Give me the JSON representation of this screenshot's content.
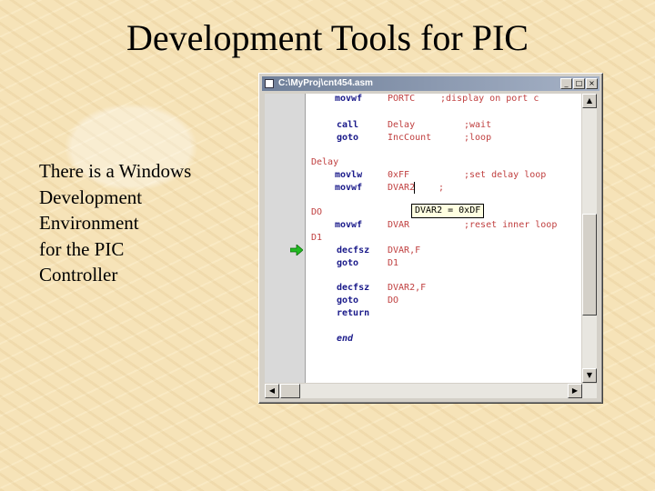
{
  "slide": {
    "title": "Development Tools for PIC",
    "body_lines": [
      "There is a Windows",
      "Development",
      "Environment",
      "for the PIC",
      "Controller"
    ]
  },
  "window": {
    "title": "C:\\MyProj\\cnt454.asm",
    "buttons": {
      "minimize": "_",
      "maximize": "□",
      "close": "×"
    }
  },
  "code": {
    "lines": [
      {
        "label": "",
        "op": "movwf",
        "arg": "PORTC",
        "comment": ";display on port c"
      },
      {
        "label": "",
        "op": "call",
        "arg": "Delay",
        "comment": ";wait"
      },
      {
        "label": "",
        "op": "goto",
        "arg": "IncCount",
        "comment": ";loop"
      },
      {
        "label": "Delay",
        "op": "",
        "arg": "",
        "comment": ""
      },
      {
        "label": "",
        "op": "movlw",
        "arg": "0xFF",
        "comment": ";set delay loop"
      },
      {
        "label": "",
        "op": "movwf",
        "arg": "DVAR2",
        "comment": ";"
      },
      {
        "label": "DO",
        "op": "",
        "arg": "",
        "comment": ""
      },
      {
        "label": "",
        "op": "movwf",
        "arg": "DVAR",
        "comment": ";reset inner loop"
      },
      {
        "label": "D1",
        "op": "",
        "arg": "",
        "comment": ""
      },
      {
        "label": "",
        "op": "decfsz",
        "arg": "DVAR,F",
        "comment": ""
      },
      {
        "label": "",
        "op": "goto",
        "arg": "D1",
        "comment": ""
      },
      {
        "label": "",
        "op": "decfsz",
        "arg": "DVAR2,F",
        "comment": ""
      },
      {
        "label": "",
        "op": "goto",
        "arg": "DO",
        "comment": ""
      },
      {
        "label": "",
        "op": "return",
        "arg": "",
        "comment": ""
      },
      {
        "label": "",
        "op": "end",
        "arg": "",
        "comment": ""
      }
    ],
    "tooltip": "DVAR2 = 0xDF"
  },
  "icons": {
    "execution_pointer": "green-arrow-icon",
    "document": "document-icon"
  },
  "colors": {
    "keyword": "#1a1a8a",
    "operand": "#c04040",
    "execution_arrow": "#22bb22",
    "titlebar": "#6f7f99"
  }
}
